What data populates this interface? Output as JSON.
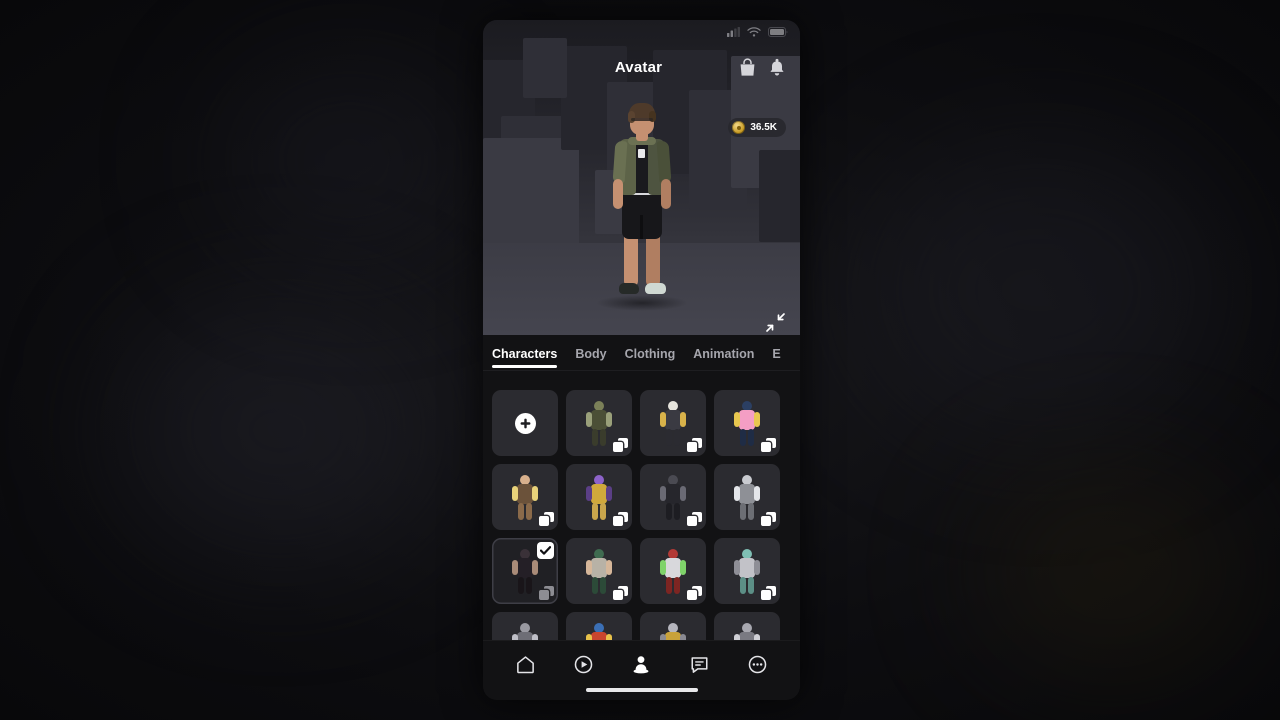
{
  "app": {
    "platform": "mobile-phone",
    "screen_bg": "#121214"
  },
  "status_bar": {
    "cellular_icon": "cellular-signal-icon",
    "wifi_icon": "wifi-icon",
    "battery_icon": "battery-icon"
  },
  "header": {
    "title": "Avatar",
    "shop_icon": "shopping-bag-icon",
    "notifications_icon": "bell-icon"
  },
  "currency": {
    "amount": "36.5K",
    "icon": "coin-icon",
    "color": "#c79a22"
  },
  "preview": {
    "expand_icon": "collapse-fullscreen-icon",
    "scene": "dark-grey-geometric-blocks",
    "avatar_description": "male avatar with brown hair, glasses, olive green jacket, black tee, black shorts, sneakers"
  },
  "tabs": {
    "active_index": 0,
    "items": [
      {
        "label": "Characters"
      },
      {
        "label": "Body"
      },
      {
        "label": "Clothing"
      },
      {
        "label": "Animation"
      },
      {
        "label": "E"
      }
    ]
  },
  "grid": {
    "add_button_icon": "plus-icon",
    "copy_icon": "duplicate-icon",
    "selected_icon": "checkmark-icon",
    "items": [
      {
        "name": "add-new-character",
        "type": "add"
      },
      {
        "name": "character-green-soldier",
        "type": "character",
        "copy": true,
        "selected": false,
        "c1": "#7b8058",
        "c2": "#4b4f36",
        "c3": "#9aa07a",
        "c4": "#3a3c2c"
      },
      {
        "name": "character-chef",
        "type": "character",
        "copy": true,
        "selected": false,
        "c1": "#e6e4dc",
        "c2": "#3a3a42",
        "c3": "#d8b24a",
        "c4": "#2b2b31"
      },
      {
        "name": "character-tutu-dancer",
        "type": "character",
        "copy": true,
        "selected": false,
        "c1": "#2b3f63",
        "c2": "#f49ec4",
        "c3": "#e8c74f",
        "c4": "#1f2c45"
      },
      {
        "name": "character-barbarian",
        "type": "character",
        "copy": true,
        "selected": false,
        "c1": "#d8b08c",
        "c2": "#6b523a",
        "c3": "#e8d27a",
        "c4": "#8a6a4a"
      },
      {
        "name": "character-purple-titan",
        "type": "character",
        "copy": true,
        "selected": false,
        "c1": "#8d63c9",
        "c2": "#d0a93c",
        "c3": "#5b3f86",
        "c4": "#c9a64c"
      },
      {
        "name": "character-dark-knight",
        "type": "character",
        "copy": true,
        "selected": false,
        "c1": "#4a4a52",
        "c2": "#26262c",
        "c3": "#6a6a74",
        "c4": "#1d1d22"
      },
      {
        "name": "character-witch",
        "type": "character",
        "copy": true,
        "selected": false,
        "c1": "#c9cbd0",
        "c2": "#8e9096",
        "c3": "#e4e6ea",
        "c4": "#6c6e74"
      },
      {
        "name": "character-dark-dress",
        "type": "character",
        "copy": true,
        "selected": true,
        "c1": "#3a3138",
        "c2": "#241f26",
        "c3": "#a98b78",
        "c4": "#191519"
      },
      {
        "name": "character-green-cardigan",
        "type": "character",
        "copy": true,
        "selected": false,
        "c1": "#3f6b50",
        "c2": "#b8b2a6",
        "c3": "#d6b79a",
        "c4": "#2c4a38"
      },
      {
        "name": "character-red-armor",
        "type": "character",
        "copy": true,
        "selected": false,
        "c1": "#b33a36",
        "c2": "#d8d8dc",
        "c3": "#7fd36a",
        "c4": "#7d2522"
      },
      {
        "name": "character-teal-robot",
        "type": "character",
        "copy": true,
        "selected": false,
        "c1": "#7fbfb4",
        "c2": "#c2c2c8",
        "c3": "#8e8e96",
        "c4": "#5c8f86"
      },
      {
        "name": "character-grey-droid",
        "type": "character",
        "copy": false,
        "selected": false,
        "c1": "#9a9aa2",
        "c2": "#6e6e76",
        "c3": "#c0c0c8",
        "c4": "#55555c"
      },
      {
        "name": "character-winged-rider",
        "type": "character",
        "copy": false,
        "selected": false,
        "c1": "#3b6fb5",
        "c2": "#c9452e",
        "c3": "#e8c24a",
        "c4": "#2a4e80"
      },
      {
        "name": "character-gold-armor",
        "type": "character",
        "copy": false,
        "selected": false,
        "c1": "#b6b6be",
        "c2": "#c9a23a",
        "c3": "#8a8a92",
        "c4": "#8c7420"
      },
      {
        "name": "character-silver-trooper",
        "type": "character",
        "copy": false,
        "selected": false,
        "c1": "#a8a8b0",
        "c2": "#7a7a82",
        "c3": "#d0d0d6",
        "c4": "#5e5e66"
      }
    ]
  },
  "bottom_nav": {
    "active_index": 2,
    "items": [
      {
        "name": "nav-home",
        "icon": "home-icon"
      },
      {
        "name": "nav-play",
        "icon": "play-circle-icon"
      },
      {
        "name": "nav-avatar",
        "icon": "avatar-person-icon"
      },
      {
        "name": "nav-chat",
        "icon": "chat-message-icon"
      },
      {
        "name": "nav-more",
        "icon": "more-dots-icon"
      }
    ]
  },
  "home_indicator": {
    "name": "home-indicator"
  }
}
